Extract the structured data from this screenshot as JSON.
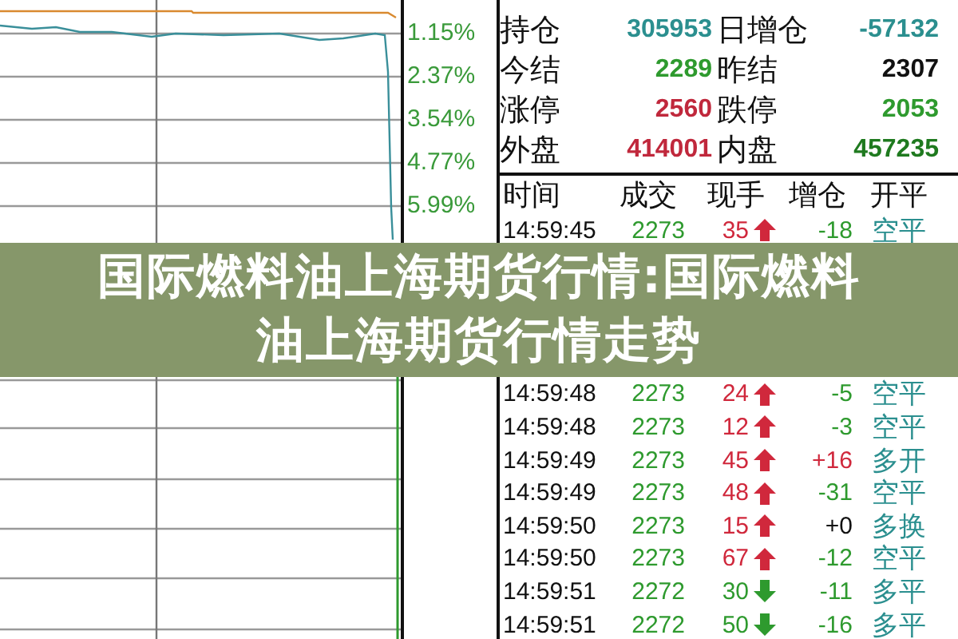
{
  "chart": {
    "axis_labels": [
      "1.15%",
      "2.37%",
      "3.54%",
      "4.77%",
      "5.99%"
    ]
  },
  "stats": [
    {
      "label": "持仓",
      "value": "305953",
      "color": "#2b8f8f"
    },
    {
      "label": "日增仓",
      "value": "-57132",
      "color": "#2b8f8f"
    },
    {
      "label": "今结",
      "value": "2289",
      "color": "#2e9a2e"
    },
    {
      "label": "昨结",
      "value": "2307",
      "color": "#111111"
    },
    {
      "label": "涨停",
      "value": "2560",
      "color": "#c0283c"
    },
    {
      "label": "跌停",
      "value": "2053",
      "color": "#2e9a2e"
    },
    {
      "label": "外盘",
      "value": "414001",
      "color": "#c0283c"
    },
    {
      "label": "内盘",
      "value": "457235",
      "color": "#1f7a1f"
    }
  ],
  "trades": {
    "columns": [
      "时间",
      "成交",
      "现手",
      "增仓",
      "开平"
    ],
    "rows": [
      {
        "time": "14:59:45",
        "price": "2273",
        "volume": "35",
        "kind": "up",
        "change": {
          "text": "-18",
          "color": "#2e9a2e"
        },
        "action": "空平"
      },
      {
        "time": "14:59:48",
        "price": "2273",
        "volume": "24",
        "kind": "up",
        "change": {
          "text": "-5",
          "color": "#2e9a2e"
        },
        "action": "空平"
      },
      {
        "time": "14:59:48",
        "price": "2273",
        "volume": "12",
        "kind": "up",
        "change": {
          "text": "-3",
          "color": "#2e9a2e"
        },
        "action": "空平"
      },
      {
        "time": "14:59:49",
        "price": "2273",
        "volume": "45",
        "kind": "up",
        "change": {
          "text": "+16",
          "color": "#d0283c"
        },
        "action": "多开"
      },
      {
        "time": "14:59:49",
        "price": "2273",
        "volume": "48",
        "kind": "up",
        "change": {
          "text": "-31",
          "color": "#2e9a2e"
        },
        "action": "空平"
      },
      {
        "time": "14:59:50",
        "price": "2273",
        "volume": "15",
        "kind": "up",
        "change": {
          "text": "+0",
          "color": "#111111"
        },
        "action": "多换"
      },
      {
        "time": "14:59:50",
        "price": "2273",
        "volume": "67",
        "kind": "up",
        "change": {
          "text": "-12",
          "color": "#2e9a2e"
        },
        "action": "空平"
      },
      {
        "time": "14:59:51",
        "price": "2272",
        "volume": "30",
        "kind": "down",
        "change": {
          "text": "-11",
          "color": "#2e9a2e"
        },
        "action": "多平"
      },
      {
        "time": "14:59:51",
        "price": "2272",
        "volume": "50",
        "kind": "down",
        "change": {
          "text": "-16",
          "color": "#2e9a2e"
        },
        "action": "多平"
      }
    ]
  },
  "banner": {
    "title": "国际燃料油上海期货行情:国际燃料油上海期货行情走势"
  }
}
